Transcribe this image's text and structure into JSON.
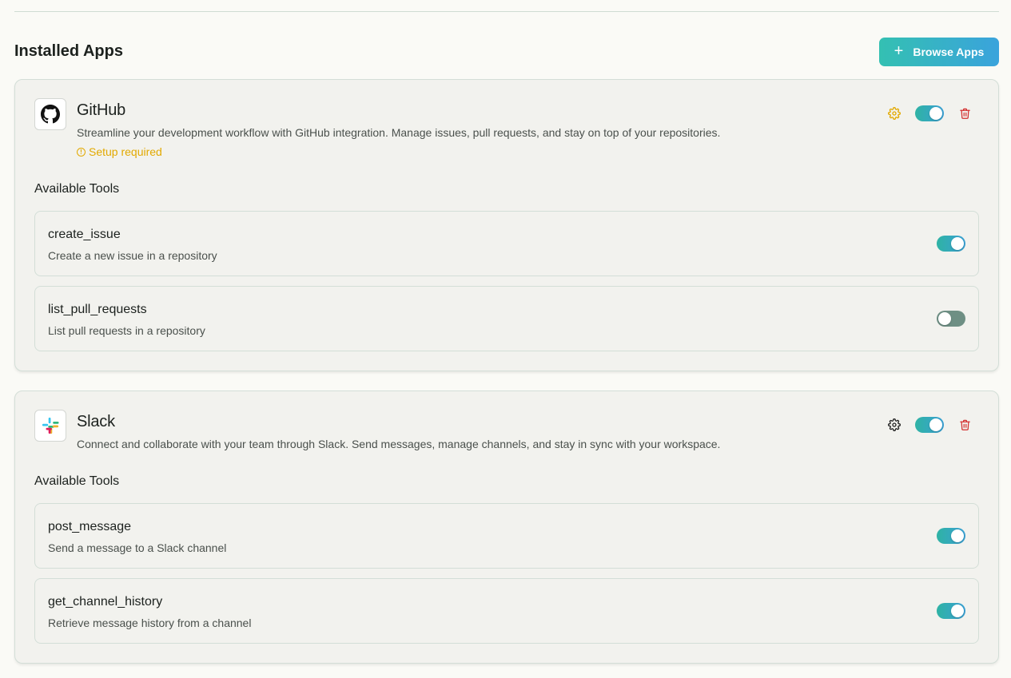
{
  "section": {
    "title": "Installed Apps",
    "browse_label": "Browse Apps",
    "browse_icon": "plus-icon"
  },
  "colors": {
    "accent_gradient_start": "#34c0b2",
    "accent_gradient_end": "#3aa3dc",
    "warning": "#e2a900",
    "danger": "#d32f2f",
    "toggle_off": "#6e8f84"
  },
  "apps": [
    {
      "name": "GitHub",
      "icon": "github-icon",
      "description": "Streamline your development workflow with GitHub integration. Manage issues, pull requests, and stay on top of your repositories.",
      "status": "Setup required",
      "enabled": true,
      "tools_title": "Available Tools",
      "tools": [
        {
          "name": "create_issue",
          "description": "Create a new issue in a repository",
          "enabled": true
        },
        {
          "name": "list_pull_requests",
          "description": "List pull requests in a repository",
          "enabled": false
        }
      ]
    },
    {
      "name": "Slack",
      "icon": "slack-icon",
      "description": "Connect and collaborate with your team through Slack. Send messages, manage channels, and stay in sync with your workspace.",
      "enabled": true,
      "tools_title": "Available Tools",
      "tools": [
        {
          "name": "post_message",
          "description": "Send a message to a Slack channel",
          "enabled": true
        },
        {
          "name": "get_channel_history",
          "description": "Retrieve message history from a channel",
          "enabled": true
        }
      ]
    }
  ]
}
